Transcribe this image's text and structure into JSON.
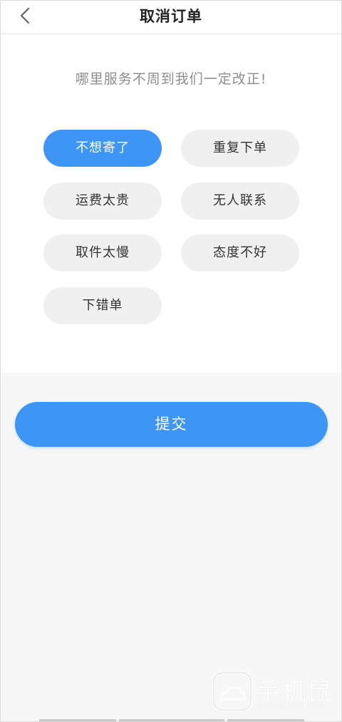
{
  "header": {
    "title": "取消订单",
    "back_icon": "chevron-left-icon"
  },
  "prompt": "哪里服务不周到我们一定改正!",
  "reasons": [
    {
      "label": "不想寄了",
      "selected": true
    },
    {
      "label": "重复下单",
      "selected": false
    },
    {
      "label": "运费太贵",
      "selected": false
    },
    {
      "label": "无人联系",
      "selected": false
    },
    {
      "label": "取件太慢",
      "selected": false
    },
    {
      "label": "态度不好",
      "selected": false
    },
    {
      "label": "下错单",
      "selected": false
    }
  ],
  "submit_label": "提交",
  "watermark": {
    "text": "手机鼠",
    "sub": "SHOUJISHU.COM"
  },
  "colors": {
    "accent": "#3d95f5",
    "chip_bg": "#f0f0f0",
    "page_bg": "#f7f7f7"
  }
}
